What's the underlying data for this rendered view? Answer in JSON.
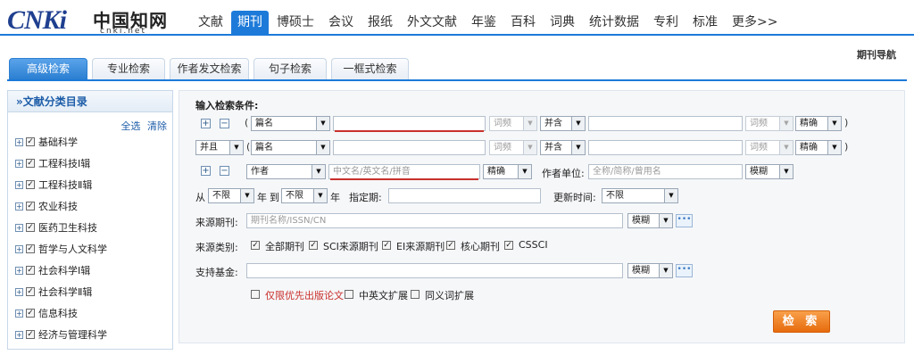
{
  "logo": {
    "cn": "CNKi",
    "zh": "中国知网",
    "url": "cnki.net"
  },
  "nav": [
    "文献",
    "期刊",
    "博硕士",
    "会议",
    "报纸",
    "外文文献",
    "年鉴",
    "百科",
    "词典",
    "统计数据",
    "专利",
    "标准",
    "更多>>"
  ],
  "nav_active": "期刊",
  "journal_nav": "期刊导航",
  "tabs": [
    "高级检索",
    "专业检索",
    "作者发文检索",
    "句子检索",
    "一框式检索"
  ],
  "sidebar": {
    "title": "»文献分类目录",
    "select_all": "全选",
    "clear": "清除",
    "items": [
      "基础科学",
      "工程科技Ⅰ辑",
      "工程科技Ⅱ辑",
      "农业科技",
      "医药卫生科技",
      "哲学与人文科学",
      "社会科学Ⅰ辑",
      "社会科学Ⅱ辑",
      "信息科技",
      "经济与管理科学"
    ]
  },
  "form": {
    "heading": "输入检索条件:",
    "row1": {
      "field": "篇名",
      "freq": "词频",
      "logic": "并含",
      "freq2": "词频",
      "match": "精确"
    },
    "row2": {
      "bool": "并且",
      "field": "篇名",
      "freq": "词频",
      "logic": "并含",
      "freq2": "词频",
      "match": "精确"
    },
    "row3": {
      "field": "作者",
      "placeholder": "中文名/英文名/拼音",
      "match": "精确",
      "unit_label": "作者单位:",
      "unit_placeholder": "全称/简称/曾用名",
      "unit_match": "模糊"
    },
    "time": {
      "from": "从",
      "from_val": "不限",
      "year1": "年",
      "to": "到",
      "to_val": "不限",
      "year2": "年",
      "specify": "指定期:",
      "update": "更新时间:",
      "update_val": "不限"
    },
    "source": {
      "label": "来源期刊:",
      "placeholder": "期刊名称/ISSN/CN",
      "match": "模糊"
    },
    "category": {
      "label": "来源类别:",
      "options": [
        "全部期刊",
        "SCI来源期刊",
        "EI来源期刊",
        "核心期刊",
        "CSSCI"
      ]
    },
    "fund": {
      "label": "支持基金:",
      "match": "模糊"
    },
    "options": {
      "online_first": "仅限优先出版论文",
      "zh_en": "中英文扩展",
      "synonym": "同义词扩展"
    },
    "search_button": "检 索",
    "dots": "•••",
    "paren_open": "(",
    "paren_close": ")",
    "plus": "+",
    "minus": "−"
  },
  "colors": {
    "accent": "#1d7ad9",
    "search_btn": "#f07f1c",
    "red_text": "#c9302c"
  }
}
